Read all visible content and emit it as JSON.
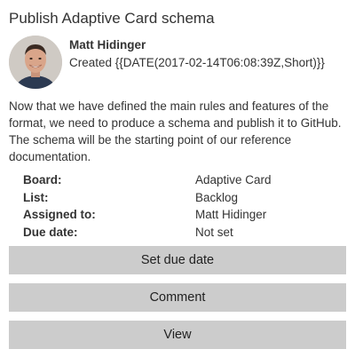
{
  "card": {
    "title": "Publish Adaptive Card schema",
    "author": "Matt Hidinger",
    "created": "Created {{DATE(2017-02-14T06:08:39Z,Short)}}",
    "description": "Now that we have defined the main rules and features of the format, we need to produce a schema and publish it to GitHub. The schema will be the starting point of our reference documentation."
  },
  "facts": [
    {
      "title": "Board:",
      "value": "Adaptive Card"
    },
    {
      "title": "List:",
      "value": "Backlog"
    },
    {
      "title": "Assigned to:",
      "value": "Matt Hidinger"
    },
    {
      "title": "Due date:",
      "value": "Not set"
    }
  ],
  "actions": {
    "due_label": "Set due date",
    "comment_label": "Comment",
    "view_label": "View"
  },
  "colors": {
    "button_bg": "#cccccc",
    "text": "#333333",
    "background": "#ffffff"
  }
}
